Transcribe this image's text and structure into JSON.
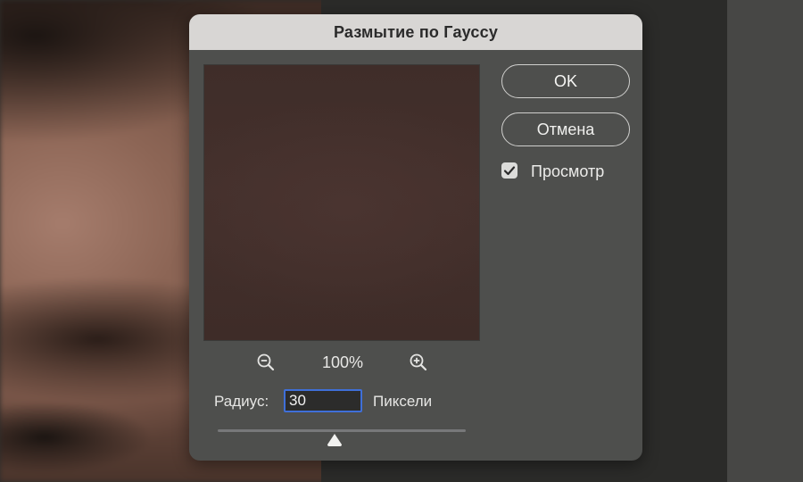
{
  "dialog": {
    "title": "Размытие по Гауссу",
    "ok_label": "OK",
    "cancel_label": "Отмена",
    "preview_label": "Просмотр",
    "preview_checked": true,
    "zoom_level": "100%",
    "radius_label": "Радиус:",
    "radius_value": "30",
    "unit_label": "Пиксели",
    "slider_value_fraction": 0.47,
    "icons": {
      "zoom_out": "zoom-out-icon",
      "zoom_in": "zoom-in-icon",
      "checkbox": "checkmark-icon",
      "slider": "triangle-thumb-icon"
    },
    "colors": {
      "accent": "#3f6fd8",
      "dialog_bg": "#4e4f4d",
      "titlebar_bg": "#d8d6d4"
    }
  }
}
